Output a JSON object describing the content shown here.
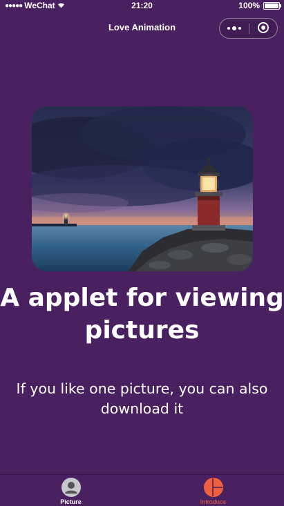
{
  "status_bar": {
    "carrier": "WeChat",
    "time": "21:20",
    "battery": "100%"
  },
  "nav_bar": {
    "title": "Love Animation"
  },
  "content": {
    "headline": "A applet for viewing pictures",
    "subtitle": "If you like one picture, you can also download it"
  },
  "tab_bar": {
    "active_color": "#f0603e",
    "inactive_color": "#ffffff",
    "tabs": [
      {
        "label": "Picture",
        "icon": "avatar-icon",
        "active": false
      },
      {
        "label": "Introduce",
        "icon": "pie-chart-icon",
        "active": true
      }
    ]
  },
  "theme": {
    "background": "#4a2160"
  }
}
